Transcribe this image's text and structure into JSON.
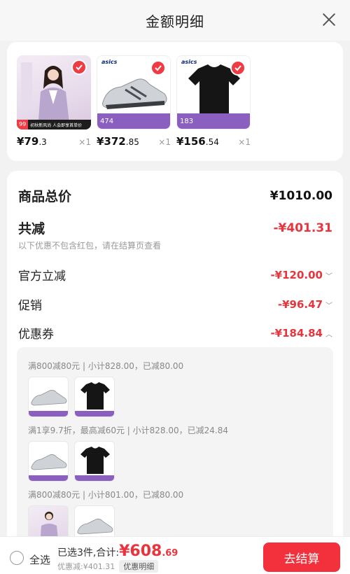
{
  "header": {
    "title": "金额明细"
  },
  "products": [
    {
      "name": "women-blouse",
      "price_int": "¥79",
      "price_dec": ".3",
      "qty": "×1",
      "promo_tag": "99",
      "promo_text": "初秋新风尚 人会即享首单价"
    },
    {
      "name": "asics-shoe",
      "price_int": "¥372",
      "price_dec": ".85",
      "qty": "×1",
      "brand": "asics",
      "tag_value": "474"
    },
    {
      "name": "asics-tshirt",
      "price_int": "¥156",
      "price_dec": ".54",
      "qty": "×1",
      "brand": "asics",
      "tag_value": "183"
    }
  ],
  "breakdown": {
    "goods_total_label": "商品总价",
    "goods_total_value": "¥1010.00",
    "reduction_label": "共减",
    "reduction_value": "-¥401.31",
    "note": "以下优惠不包含红包，请在结算页查看",
    "official_label": "官方立减",
    "official_value": "-¥120.00",
    "promo_label": "促销",
    "promo_value": "-¥96.47",
    "coupon_label": "优惠券",
    "coupon_value": "-¥184.84"
  },
  "coupons": [
    {
      "text": "满800减80元 | 小计828.00，已减80.00"
    },
    {
      "text": "满1享9.7折，最高减60元 | 小计828.00，已减24.84"
    },
    {
      "text": "满800减80元 | 小计801.00，已减80.00"
    }
  ],
  "bottom": {
    "select_all": "全选",
    "selected_text": "已选3件,合计:",
    "total_int": "¥608",
    "total_dec": ".69",
    "discount_text": "优惠减:¥401.31",
    "detail_tag": "优惠明细",
    "checkout": "去结算"
  },
  "colors": {
    "accent": "#e8343c",
    "button": "#f2313d",
    "purple_tag": "#8b5fbf"
  }
}
